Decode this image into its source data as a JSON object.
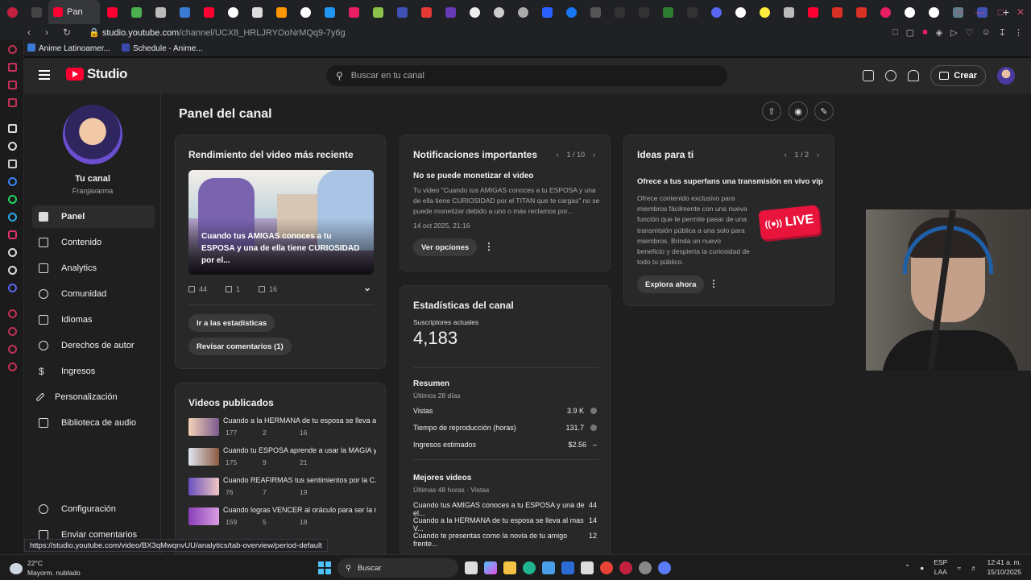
{
  "browser": {
    "active_tab_label": "Pan",
    "url_prefix": "studio.youtube.com",
    "url_path": "/channel/UCX8_HRLJRYOoNrMQq9-7y6g",
    "bookmarks": [
      "Anime Latinoamer...",
      "Schedule - Anime..."
    ],
    "status_url": "https://studio.youtube.com/video/BX3qMwqnvUU/analytics/tab-overview/period-default"
  },
  "header": {
    "logo_text": "Studio",
    "search_placeholder": "Buscar en tu canal",
    "create_label": "Crear"
  },
  "sidebar": {
    "channel_title": "Tu canal",
    "channel_name": "Franjavarma",
    "items": [
      {
        "label": "Panel",
        "icon": "dashboard-icon"
      },
      {
        "label": "Contenido",
        "icon": "content-icon"
      },
      {
        "label": "Analytics",
        "icon": "analytics-icon"
      },
      {
        "label": "Comunidad",
        "icon": "community-icon"
      },
      {
        "label": "Idiomas",
        "icon": "subtitles-icon"
      },
      {
        "label": "Derechos de autor",
        "icon": "copyright-icon"
      },
      {
        "label": "Ingresos",
        "icon": "money-icon"
      },
      {
        "label": "Personalización",
        "icon": "wand-icon"
      },
      {
        "label": "Biblioteca de audio",
        "icon": "audio-library-icon"
      }
    ],
    "bottom_items": [
      {
        "label": "Configuración",
        "icon": "gear-icon"
      },
      {
        "label": "Enviar comentarios",
        "icon": "feedback-icon"
      }
    ]
  },
  "main": {
    "page_title": "Panel del canal",
    "latest_video": {
      "title": "Rendimiento del video más reciente",
      "thumb_caption": "Cuando tus AMIGAS conoces a tu ESPOSA y una de ella tiene CURIOSIDAD por el...",
      "views": "44",
      "comments": "1",
      "likes": "16",
      "btn_stats": "Ir a las estadísticas",
      "btn_comments": "Revisar comentarios (1)"
    },
    "published": {
      "title": "Videos publicados",
      "videos": [
        {
          "title": "Cuando a la HERMANA de tu esposa se lleva a...",
          "views": "177",
          "comments": "2",
          "likes": "16"
        },
        {
          "title": "Cuando tu ESPOSA aprende a usar la MAGIA y ...",
          "views": "175",
          "comments": "9",
          "likes": "21"
        },
        {
          "title": "Cuando REAFIRMAS tus sentimientos por la C...",
          "views": "76",
          "comments": "7",
          "likes": "19"
        },
        {
          "title": "Cuando logras VENCER al oráculo para ser la n...",
          "views": "159",
          "comments": "5",
          "likes": "18"
        }
      ]
    },
    "notifications": {
      "title": "Notificaciones importantes",
      "pager": "1 / 10",
      "heading": "No se puede monetizar el video",
      "body": "Tu video \"Cuando tus AMIGAS conoces a tu ESPOSA y una de ella tiene CURIOSIDAD por el TITAN que te cargas\" no se puede monetizar debido a uno o más reclamos por...",
      "date": "14 oct 2025, 21:16",
      "button": "Ver opciones"
    },
    "stats": {
      "title": "Estadísticas del canal",
      "subs_label": "Suscriptores actuales",
      "subs_value": "4,183",
      "summary_title": "Resumen",
      "summary_period": "Últimos 28 días",
      "metrics": [
        {
          "label": "Vistas",
          "value": "3.9 K"
        },
        {
          "label": "Tiempo de reproducción (horas)",
          "value": "131.7"
        },
        {
          "label": "Ingresos estimados",
          "value": "$2.56"
        }
      ],
      "top_title": "Mejores videos",
      "top_period": "Últimas 48 horas · Vistas",
      "top_videos": [
        {
          "title": "Cuando tus AMIGAS conoces a tu ESPOSA y una de el...",
          "value": "44"
        },
        {
          "title": "Cuando a la HERMANA de tu esposa se lleva al mas V...",
          "value": "14"
        },
        {
          "title": "Cuando te presentas como la novia de tu amigo frente...",
          "value": "12"
        }
      ]
    },
    "ideas": {
      "title": "Ideas para ti",
      "pager": "1 / 2",
      "heading": "Ofrece a tus superfans una transmisión en vivo vip",
      "body": "Ofrece contenido exclusivo para miembros fácilmente con una nueva función que te permite pasar de una transmisión pública a una solo para miembros. Brinda un nuevo beneficio y despierta la curiosidad de todo tu público.",
      "live_text": "LIVE",
      "button": "Explora ahora"
    }
  },
  "taskbar": {
    "temp": "22°C",
    "weather": "Mayorm. nublado",
    "search_label": "Buscar",
    "lang1": "ESP",
    "lang2": "LAA",
    "time": "12:41 a. m.",
    "date": "15/10/2025"
  },
  "colors": {
    "brand_red": "#ff0033",
    "bg": "#1f1f1f",
    "card": "#282828"
  }
}
